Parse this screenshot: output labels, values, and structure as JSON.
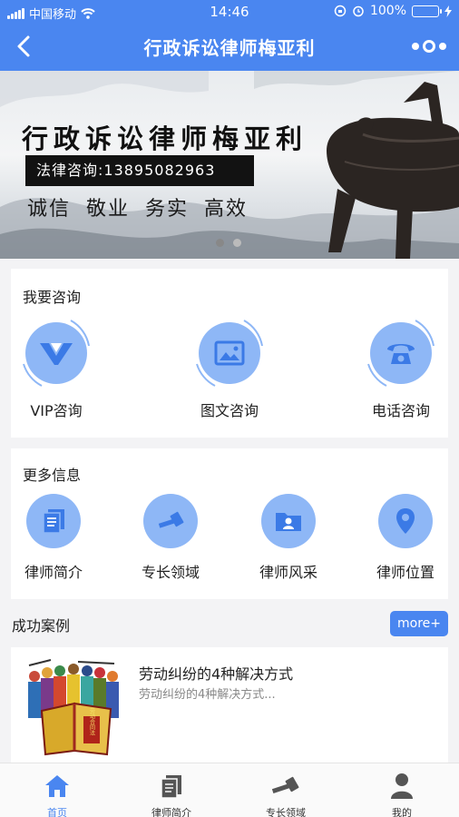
{
  "status_bar": {
    "carrier": "中国移动",
    "time": "14:46",
    "battery": "100%"
  },
  "nav": {
    "title": "行政诉讼律师梅亚利"
  },
  "banner": {
    "title": "行政诉讼律师梅亚利",
    "phone": "法律咨询:13895082963",
    "slogan": "诚信 敬业 务实 高效",
    "slides": 2,
    "active_slide": 1
  },
  "consult": {
    "title": "我要咨询",
    "items": [
      {
        "label": "VIP咨询",
        "icon": "vip-icon"
      },
      {
        "label": "图文咨询",
        "icon": "image-icon"
      },
      {
        "label": "电话咨询",
        "icon": "telephone-icon"
      }
    ]
  },
  "more_info": {
    "title": "更多信息",
    "items": [
      {
        "label": "律师简介",
        "icon": "document-icon"
      },
      {
        "label": "专长领域",
        "icon": "gavel-icon"
      },
      {
        "label": "律师风采",
        "icon": "profile-folder-icon"
      },
      {
        "label": "律师位置",
        "icon": "location-pin-icon"
      }
    ]
  },
  "cases": {
    "title": "成功案例",
    "more_label": "more+",
    "items": [
      {
        "title": "劳动纠纷的4种解决方式",
        "desc": "劳动纠纷的4种解决方式...",
        "book_text": "劳动合同法"
      }
    ]
  },
  "tabbar": {
    "items": [
      {
        "label": "首页",
        "icon": "home-icon",
        "active": true
      },
      {
        "label": "律师简介",
        "icon": "document-icon",
        "active": false
      },
      {
        "label": "专长领域",
        "icon": "gavel-icon",
        "active": false
      },
      {
        "label": "我的",
        "icon": "user-icon",
        "active": false
      }
    ]
  },
  "colors": {
    "primary": "#4a86f0",
    "icon_disc": "#8eb7f6",
    "icon_glyph": "#3b7ae6"
  }
}
